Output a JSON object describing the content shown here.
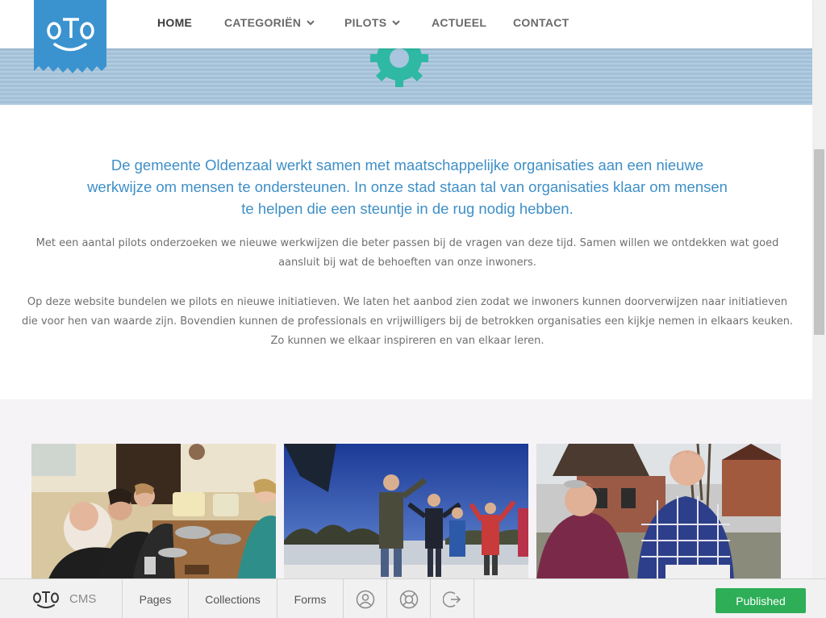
{
  "nav": {
    "items": [
      {
        "label": "HOME",
        "active": true,
        "has_dropdown": false
      },
      {
        "label": "CATEGORIËN",
        "active": false,
        "has_dropdown": true
      },
      {
        "label": "PILOTS",
        "active": false,
        "has_dropdown": true
      },
      {
        "label": "ACTUEEL",
        "active": false,
        "has_dropdown": false
      },
      {
        "label": "CONTACT",
        "active": false,
        "has_dropdown": false
      }
    ]
  },
  "logo": {
    "text": "OTO",
    "icon": "oto-smile-logo",
    "color": "#3a93cf"
  },
  "banner": {
    "gear_color": "#2fb8a3",
    "background": "#a9c6de"
  },
  "intro": {
    "lead": "De gemeente Oldenzaal werkt samen met maatschappelijke organisaties aan een nieuwe werkwijze om mensen te ondersteunen. In onze stad staan tal van organisaties klaar om mensen te helpen die een steuntje in de rug nodig hebben.",
    "para1": "Met een aantal pilots onderzoeken we nieuwe werkwijzen die beter passen bij de vragen van deze tijd. Samen willen we ontdekken wat goed aansluit bij wat de behoeften van onze inwoners.",
    "para2": "Op deze website bundelen we pilots en nieuwe initiatieven. We laten het aanbod zien zodat we inwoners kunnen doorverwijzen naar initiatieven die voor hen van waarde zijn. Bovendien kunnen de professionals en vrijwilligers bij de betrokken organisaties een kijkje nemen in elkaars keuken. Zo kunnen we elkaar inspireren en van elkaar leren."
  },
  "gallery": {
    "photos": [
      {
        "icon": "photo-cooking-group"
      },
      {
        "icon": "photo-outdoor-exercise"
      },
      {
        "icon": "photo-farm-workers"
      }
    ]
  },
  "cms": {
    "brand_logo": "OTO",
    "brand_label": "CMS",
    "tabs": [
      "Pages",
      "Collections",
      "Forms"
    ],
    "icons": [
      "user-icon",
      "help-lifebuoy-icon",
      "logout-icon"
    ],
    "publish_label": "Published",
    "publish_color": "#2dae57"
  },
  "colors": {
    "accent": "#3e8fc7",
    "text": "#6f6f6f"
  }
}
